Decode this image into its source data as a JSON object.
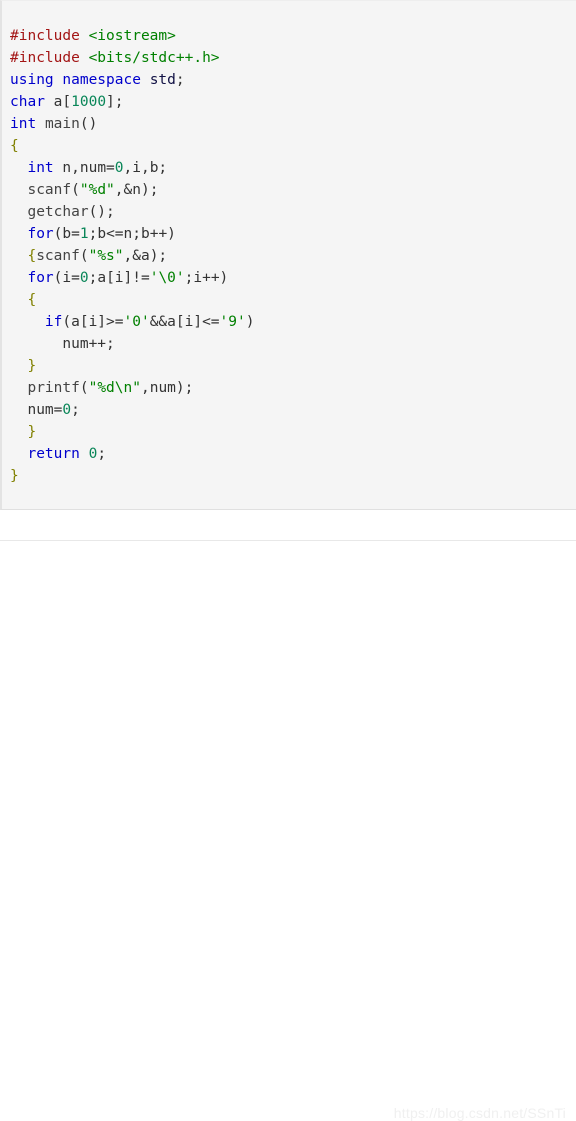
{
  "code_block": {
    "language": "cpp",
    "background_color": "#f5f5f5",
    "lines": [
      {
        "indent": 0,
        "tokens": [
          {
            "t": "#include ",
            "c": "pre"
          },
          {
            "t": "<iostream>",
            "c": "inc"
          }
        ]
      },
      {
        "indent": 0,
        "tokens": [
          {
            "t": "#include ",
            "c": "pre"
          },
          {
            "t": "<bits/stdc++.h>",
            "c": "inc"
          }
        ]
      },
      {
        "indent": 0,
        "tokens": [
          {
            "t": "using",
            "c": "kw"
          },
          {
            "t": " ",
            "c": "plain"
          },
          {
            "t": "namespace",
            "c": "kw"
          },
          {
            "t": " ",
            "c": "plain"
          },
          {
            "t": "std",
            "c": "id"
          },
          {
            "t": ";",
            "c": "plain"
          }
        ]
      },
      {
        "indent": 0,
        "tokens": [
          {
            "t": "char",
            "c": "kw"
          },
          {
            "t": " a[",
            "c": "plain"
          },
          {
            "t": "1000",
            "c": "num"
          },
          {
            "t": "];",
            "c": "plain"
          }
        ]
      },
      {
        "indent": 0,
        "tokens": [
          {
            "t": "int",
            "c": "kw"
          },
          {
            "t": " ",
            "c": "plain"
          },
          {
            "t": "main",
            "c": "fn"
          },
          {
            "t": "()",
            "c": "plain"
          }
        ]
      },
      {
        "indent": 0,
        "tokens": [
          {
            "t": "{",
            "c": "br"
          }
        ]
      },
      {
        "indent": 1,
        "tokens": [
          {
            "t": "int",
            "c": "kw"
          },
          {
            "t": " n,num=",
            "c": "plain"
          },
          {
            "t": "0",
            "c": "num"
          },
          {
            "t": ",i,b;",
            "c": "plain"
          }
        ]
      },
      {
        "indent": 1,
        "tokens": [
          {
            "t": "scanf",
            "c": "fn"
          },
          {
            "t": "(",
            "c": "plain"
          },
          {
            "t": "\"%d\"",
            "c": "str"
          },
          {
            "t": ",&n);",
            "c": "plain"
          }
        ]
      },
      {
        "indent": 1,
        "tokens": [
          {
            "t": "getchar",
            "c": "fn"
          },
          {
            "t": "();",
            "c": "plain"
          }
        ]
      },
      {
        "indent": 1,
        "tokens": [
          {
            "t": "for",
            "c": "kw"
          },
          {
            "t": "(b=",
            "c": "plain"
          },
          {
            "t": "1",
            "c": "num"
          },
          {
            "t": ";b<=n;b++)",
            "c": "plain"
          }
        ]
      },
      {
        "indent": 1,
        "tokens": [
          {
            "t": "{",
            "c": "br"
          },
          {
            "t": "scanf",
            "c": "fn"
          },
          {
            "t": "(",
            "c": "plain"
          },
          {
            "t": "\"%s\"",
            "c": "str"
          },
          {
            "t": ",&a);",
            "c": "plain"
          }
        ]
      },
      {
        "indent": 1,
        "tokens": [
          {
            "t": "for",
            "c": "kw"
          },
          {
            "t": "(i=",
            "c": "plain"
          },
          {
            "t": "0",
            "c": "num"
          },
          {
            "t": ";a[i]!=",
            "c": "plain"
          },
          {
            "t": "'\\0'",
            "c": "str"
          },
          {
            "t": ";i++)",
            "c": "plain"
          }
        ]
      },
      {
        "indent": 1,
        "tokens": [
          {
            "t": "{",
            "c": "br"
          }
        ]
      },
      {
        "indent": 2,
        "tokens": [
          {
            "t": "if",
            "c": "kw"
          },
          {
            "t": "(a[i]>=",
            "c": "plain"
          },
          {
            "t": "'0'",
            "c": "str"
          },
          {
            "t": "&&a[i]<=",
            "c": "plain"
          },
          {
            "t": "'9'",
            "c": "str"
          },
          {
            "t": ")",
            "c": "plain"
          }
        ]
      },
      {
        "indent": 3,
        "tokens": [
          {
            "t": "num++;",
            "c": "plain"
          }
        ]
      },
      {
        "indent": 1,
        "tokens": [
          {
            "t": "}",
            "c": "br"
          }
        ]
      },
      {
        "indent": 1,
        "tokens": [
          {
            "t": "printf",
            "c": "fn"
          },
          {
            "t": "(",
            "c": "plain"
          },
          {
            "t": "\"%d\\n\"",
            "c": "str"
          },
          {
            "t": ",num);",
            "c": "plain"
          }
        ]
      },
      {
        "indent": 1,
        "tokens": [
          {
            "t": "num=",
            "c": "plain"
          },
          {
            "t": "0",
            "c": "num"
          },
          {
            "t": ";",
            "c": "plain"
          }
        ]
      },
      {
        "indent": 1,
        "tokens": [
          {
            "t": "}",
            "c": "br"
          }
        ]
      },
      {
        "indent": 1,
        "tokens": [
          {
            "t": "return",
            "c": "kw"
          },
          {
            "t": " ",
            "c": "plain"
          },
          {
            "t": "0",
            "c": "num"
          },
          {
            "t": ";",
            "c": "plain"
          }
        ]
      },
      {
        "indent": 0,
        "tokens": [
          {
            "t": "}",
            "c": "br"
          }
        ]
      }
    ]
  },
  "watermark": {
    "text": "https://blog.csdn.net/SSnTi",
    "color": "#f0f0f0"
  }
}
